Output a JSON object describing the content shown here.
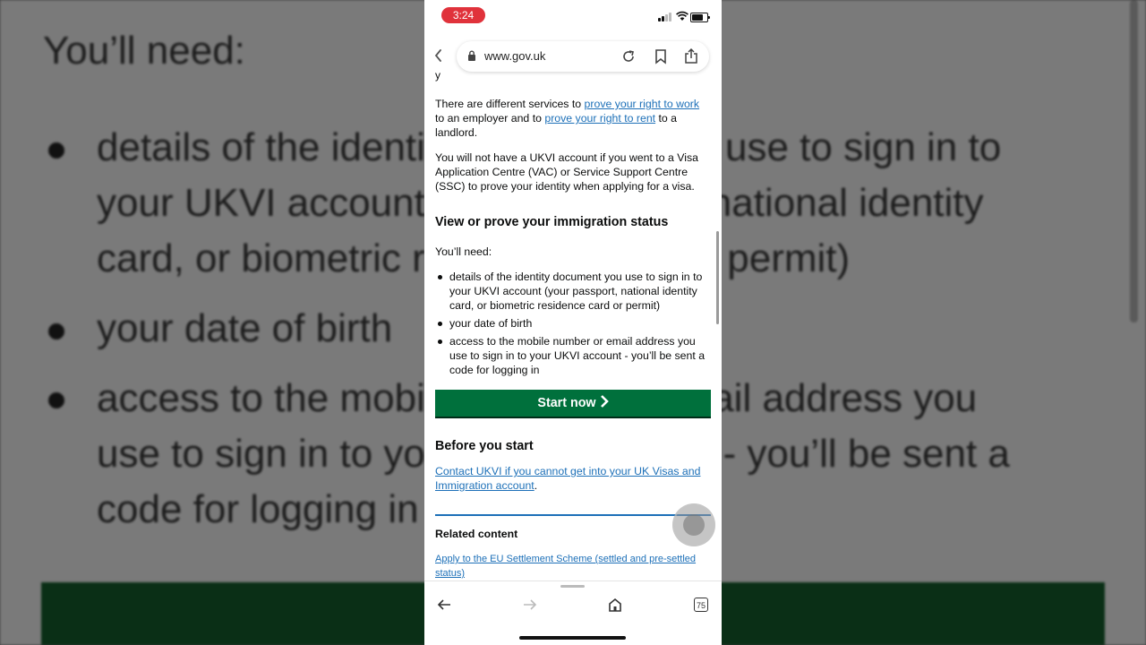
{
  "status": {
    "time": "3:24"
  },
  "browser": {
    "url": "www.gov.uk",
    "tabs_count": "75"
  },
  "page": {
    "partial_top": "y",
    "p1_pre": "There are different services to ",
    "p1_link1": "prove your right to work",
    "p1_mid": " to an employer and to ",
    "p1_link2": "prove your right to rent",
    "p1_post": " to a landlord.",
    "p2": "You will not have a UKVI account if you went to a Visa Application Centre (VAC) or Service Support Centre (SSC) to prove your identity when applying for a visa.",
    "heading": "View or prove your immigration status",
    "need_intro": "You’ll need:",
    "need_items": [
      "details of the identity document you use to sign in to your UKVI account (your passport, national identity card, or biometric residence card or permit)",
      "your date of birth",
      "access to the mobile number or email address you use to sign in to your UKVI account - you’ll be sent a code for logging in"
    ],
    "start_button": "Start now",
    "before_heading": "Before you start",
    "contact_link": "Contact UKVI if you cannot get into your UK Visas and Immigration account",
    "contact_post": ".",
    "related_heading": "Related content",
    "related_link": "Apply to the EU Settlement Scheme (settled and pre-settled status)"
  },
  "background": {
    "line1": "You’ll need:",
    "line2": "details of the identity document you use to sign in to",
    "line3": "your UKVI account (your passport, national identity",
    "line4": "card, or biometric residence card or permit)",
    "line5": "your date of birth",
    "line6": "access to the mobile number or email address you",
    "line7": "use to sign in to your UKVI account - you’ll be sent a",
    "line8": "code for logging in"
  },
  "colors": {
    "link": "#1d70b8",
    "start_button": "#00703c",
    "time_pill": "#e0323b"
  }
}
